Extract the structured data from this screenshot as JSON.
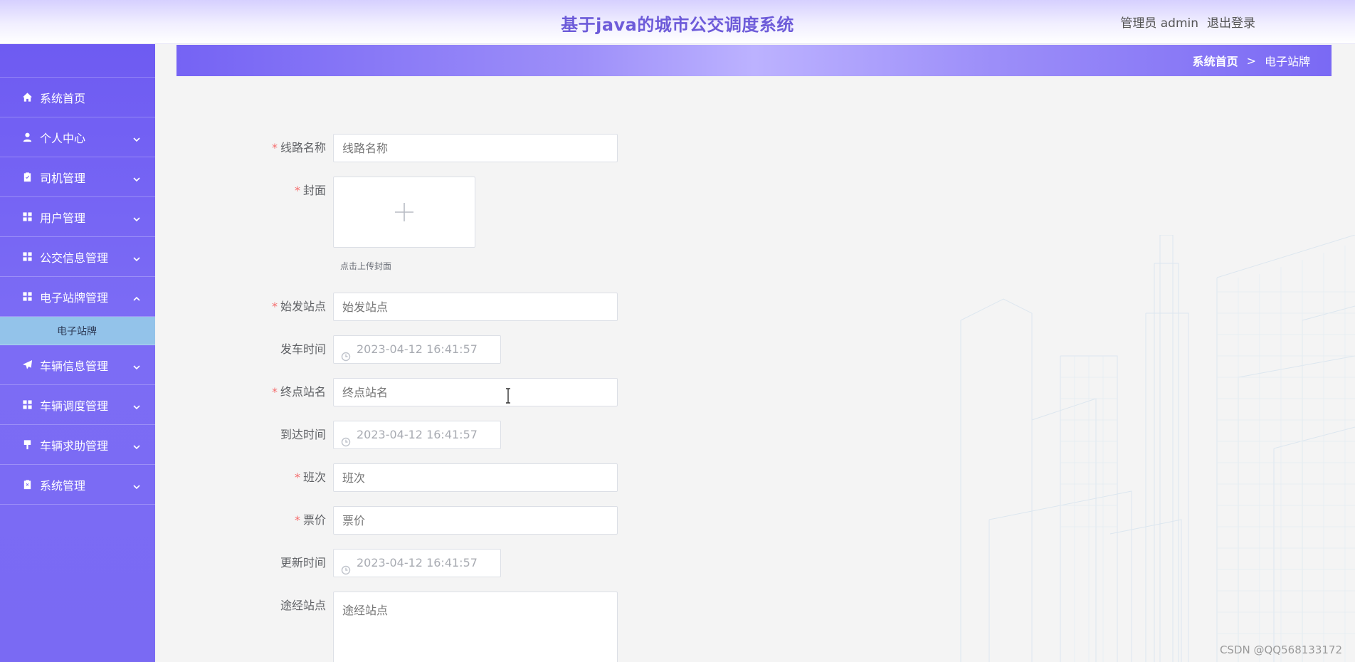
{
  "header": {
    "title": "基于java的城市公交调度系统",
    "user_label": "管理员 admin",
    "logout_label": "退出登录"
  },
  "sidebar": {
    "items": [
      {
        "label": "系统首页",
        "icon": "home-icon"
      },
      {
        "label": "个人中心",
        "icon": "user-icon"
      },
      {
        "label": "司机管理",
        "icon": "clipboard-icon"
      },
      {
        "label": "用户管理",
        "icon": "grid-icon"
      },
      {
        "label": "公交信息管理",
        "icon": "grid-icon"
      },
      {
        "label": "电子站牌管理",
        "icon": "grid-icon",
        "expanded": true
      },
      {
        "label": "车辆信息管理",
        "icon": "paper-plane-icon"
      },
      {
        "label": "车辆调度管理",
        "icon": "grid-icon"
      },
      {
        "label": "车辆求助管理",
        "icon": "brush-icon"
      },
      {
        "label": "系统管理",
        "icon": "clipboard-x-icon"
      }
    ],
    "subitem": "电子站牌"
  },
  "breadcrumb": {
    "home": "系统首页",
    "separator": ">",
    "current": "电子站牌"
  },
  "form": {
    "route_name": {
      "label": "线路名称",
      "placeholder": "线路名称",
      "required": true
    },
    "cover": {
      "label": "封面",
      "hint": "点击上传封面",
      "required": true
    },
    "start_station": {
      "label": "始发站点",
      "placeholder": "始发站点",
      "required": true
    },
    "depart_time": {
      "label": "发车时间",
      "value": "2023-04-12 16:41:57"
    },
    "end_station": {
      "label": "终点站名",
      "placeholder": "终点站名",
      "required": true
    },
    "arrive_time": {
      "label": "到达时间",
      "value": "2023-04-12 16:41:57"
    },
    "shift": {
      "label": "班次",
      "placeholder": "班次",
      "required": true
    },
    "fare": {
      "label": "票价",
      "placeholder": "票价",
      "required": true
    },
    "update_time": {
      "label": "更新时间",
      "value": "2023-04-12 16:41:57"
    },
    "via_stations": {
      "label": "途经站点",
      "placeholder": "途经站点"
    }
  },
  "watermark": "CSDN @QQ568133172",
  "colors": {
    "accent": "#6d5bd9",
    "sidebar": "#7463f3",
    "submenu_active": "#93c3ea",
    "required": "#f56c6c"
  }
}
